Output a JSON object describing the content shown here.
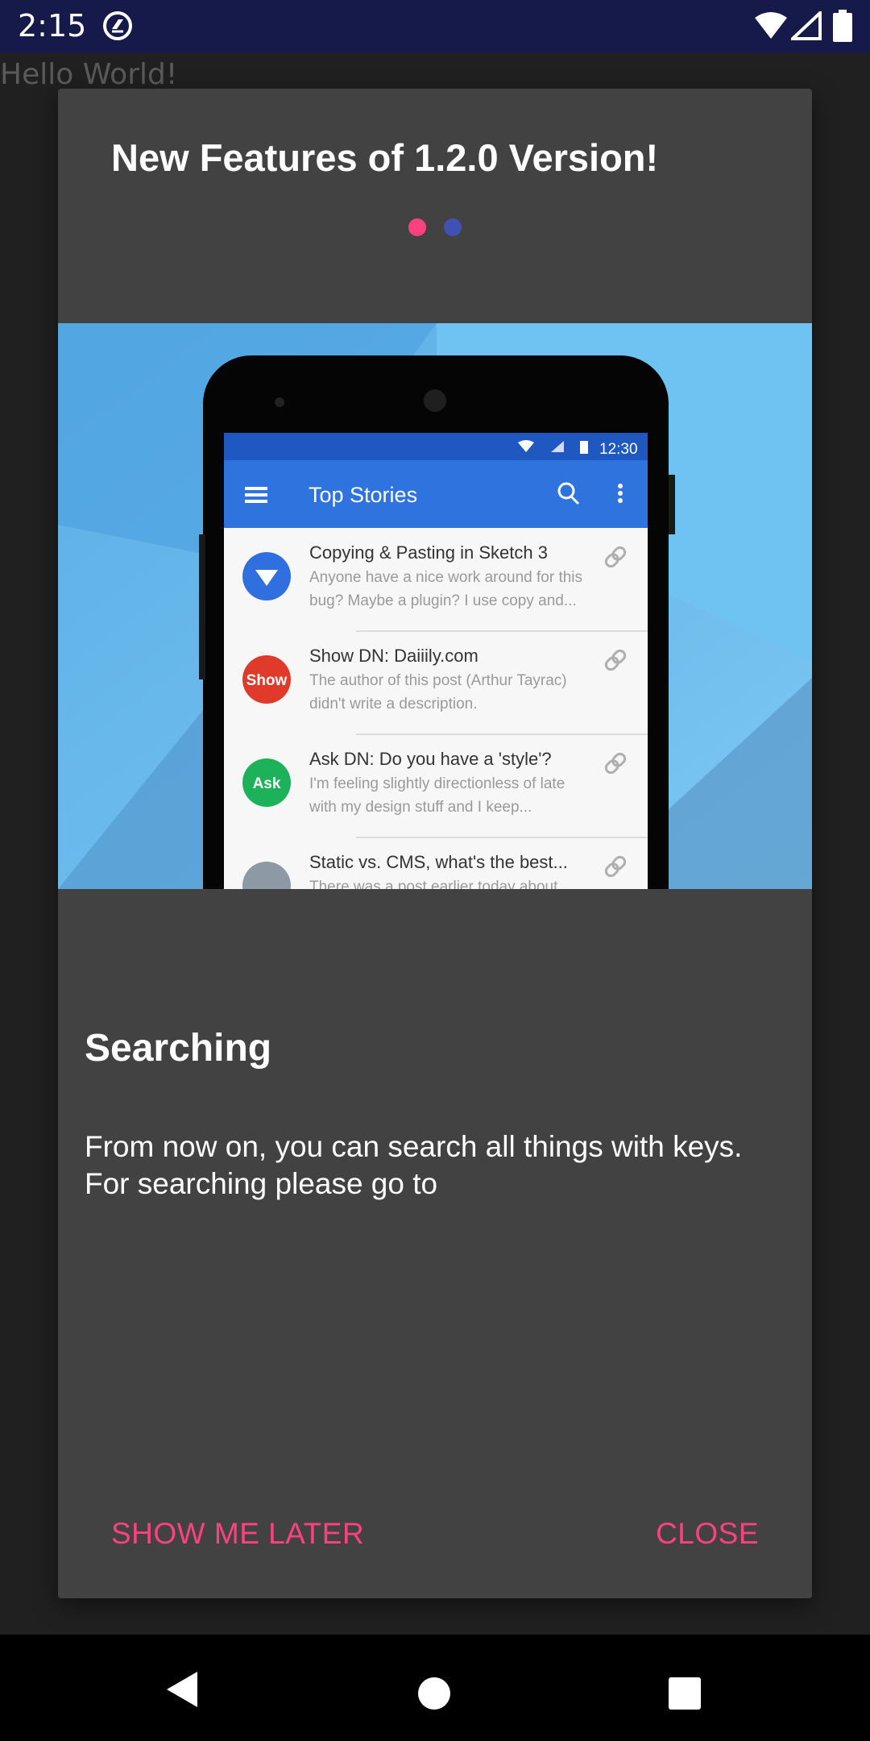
{
  "status_bar": {
    "time": "2:15",
    "icons": [
      "app-notification-icon",
      "wifi-icon",
      "cell-signal-icon",
      "battery-icon"
    ]
  },
  "background": {
    "text": "Hello World!"
  },
  "dialog": {
    "title": "New Features of 1.2.0 Version!",
    "page_indicator": {
      "count": 2,
      "active_color": "#ff4081",
      "inactive_color": "#3f51b5"
    },
    "feature": {
      "title": "Searching",
      "description": "From now on, you can search all things with keys. For searching please go to"
    },
    "image": {
      "status_time": "12:30",
      "toolbar_title": "Top Stories",
      "stories": [
        {
          "avatar": "",
          "title": "Copying & Pasting in Sketch 3",
          "line1": "Anyone have a nice work around for this",
          "line2": "bug? Maybe a plugin? I use copy and...",
          "color": "#2f6fe0"
        },
        {
          "avatar": "Show",
          "title": "Show DN: Daiiily.com",
          "line1": "The author of this post (Arthur Tayrac)",
          "line2": "didn't write a description.",
          "color": "#e03a2a"
        },
        {
          "avatar": "Ask",
          "title": "Ask DN: Do you have a 'style'?",
          "line1": "I'm feeling slightly directionless of late",
          "line2": "with my design stuff and I keep...",
          "color": "#1db25a"
        },
        {
          "avatar": "",
          "title": "Static vs. CMS, what's the best...",
          "line1": "There was a post earlier today about",
          "line2": "",
          "color": "#8e99a6"
        }
      ]
    },
    "buttons": {
      "later": "SHOW ME LATER",
      "close": "CLOSE"
    }
  },
  "colors": {
    "accent": "#ff4081",
    "dialog_bg": "#424242",
    "status_bar": "#151a4b"
  }
}
